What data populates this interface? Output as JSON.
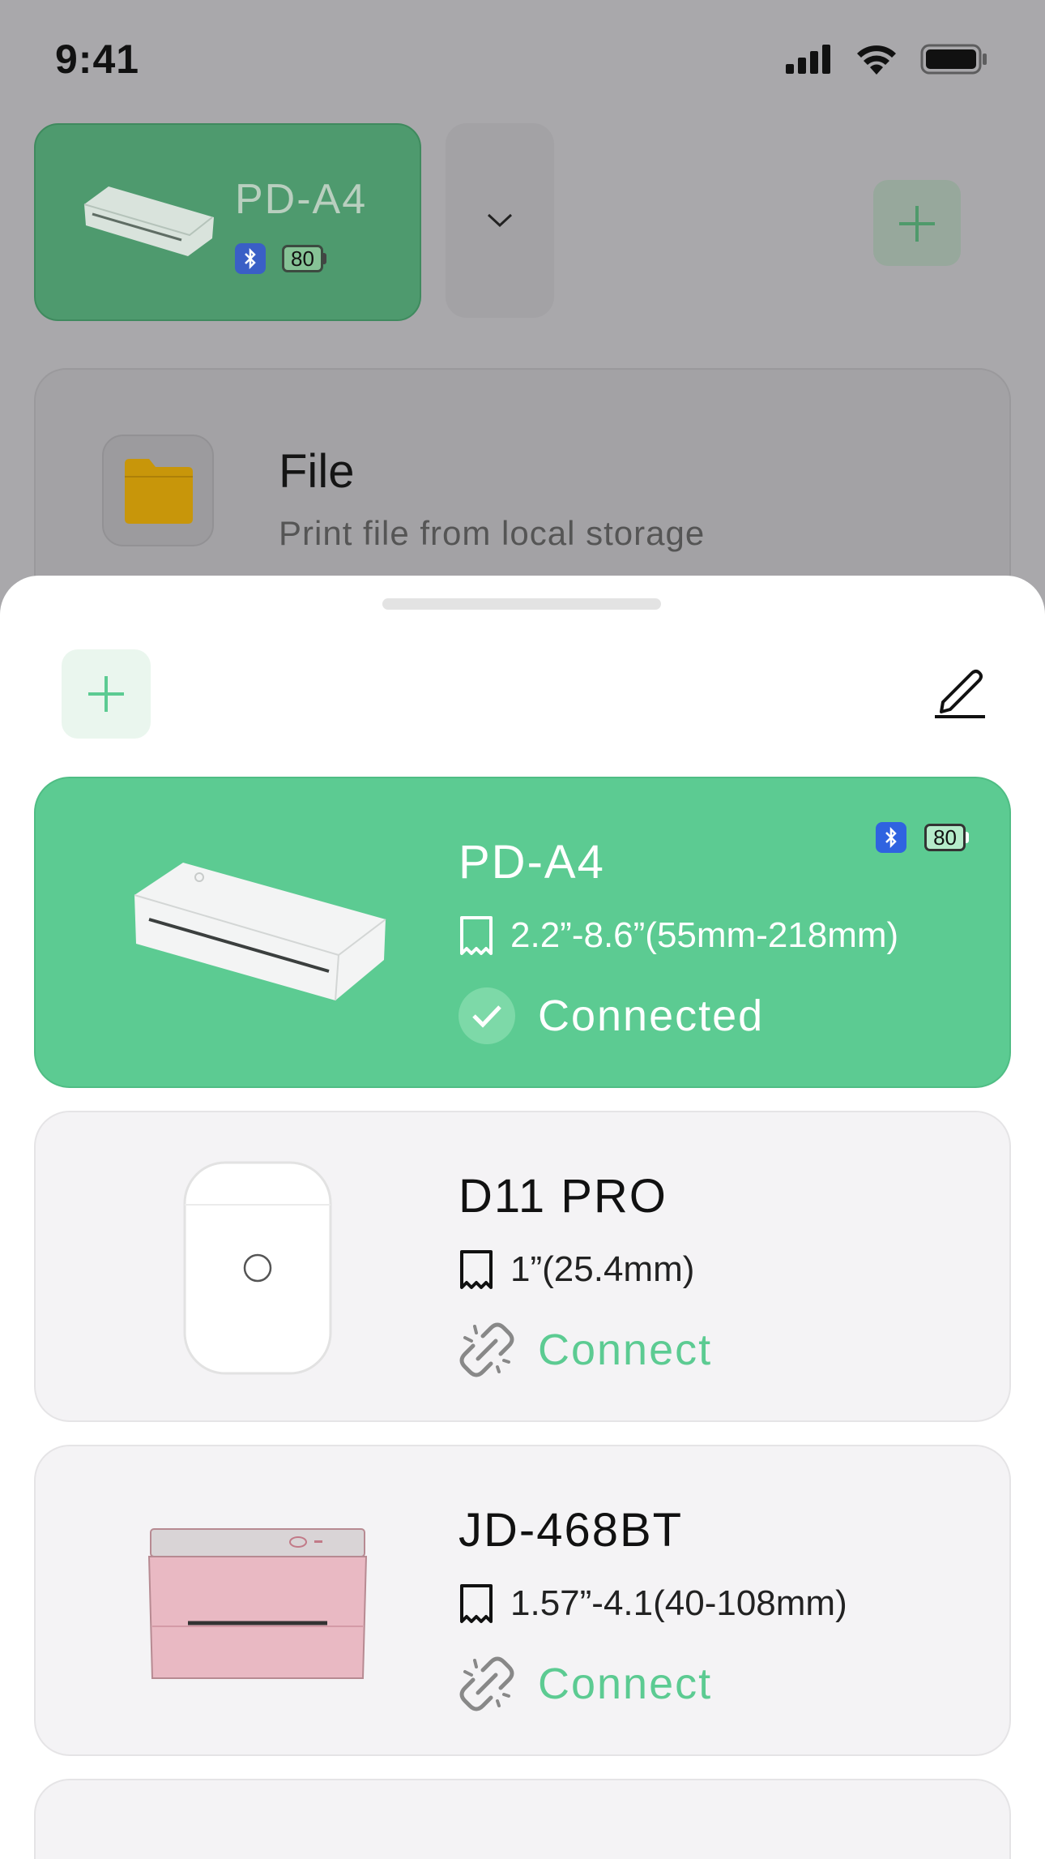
{
  "status": {
    "time": "9:41"
  },
  "background": {
    "current_device": {
      "name": "PD-A4",
      "battery": "80"
    },
    "file_card": {
      "title": "File",
      "subtitle": "Print file from local storage"
    }
  },
  "sheet": {
    "devices": [
      {
        "name": "PD-A4",
        "paper": "2.2”-8.6”(55mm-218mm)",
        "status": "Connected",
        "battery": "80"
      },
      {
        "name": "D11 PRO",
        "paper": "1”(25.4mm)",
        "status": "Connect"
      },
      {
        "name": "JD-468BT",
        "paper": "1.57”-4.1(40-108mm)",
        "status": "Connect"
      }
    ]
  },
  "colors": {
    "accent": "#5ccb92",
    "bluetooth": "#2f63e0",
    "folder": "#c8960a"
  }
}
